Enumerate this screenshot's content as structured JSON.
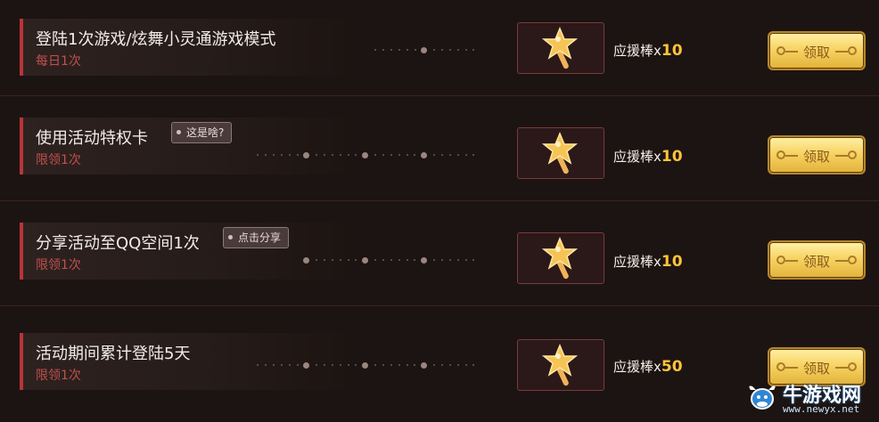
{
  "tasks": [
    {
      "title": "登陆1次游戏/炫舞小灵通游戏模式",
      "limit": "每日1次",
      "tag": "",
      "reward_name": "应援棒",
      "reward_x": "x",
      "reward_count": "10",
      "claim_label": "领取"
    },
    {
      "title": "使用活动特权卡",
      "limit": "限领1次",
      "tag": "这是啥?",
      "reward_name": "应援棒",
      "reward_x": "x",
      "reward_count": "10",
      "claim_label": "领取"
    },
    {
      "title": "分享活动至QQ空间1次",
      "limit": "限领1次",
      "tag": "点击分享",
      "reward_name": "应援棒",
      "reward_x": "x",
      "reward_count": "10",
      "claim_label": "领取"
    },
    {
      "title": "活动期间累计登陆5天",
      "limit": "限领1次",
      "tag": "",
      "reward_name": "应援棒",
      "reward_x": "x",
      "reward_count": "50",
      "claim_label": "领取"
    }
  ],
  "reward_icon": "star-wand-icon",
  "colors": {
    "accent": "#b8353a",
    "gold": "#ffc43a",
    "button": "#f7d463"
  },
  "watermark": {
    "brand": "牛游戏网",
    "url": "www.newyx.net",
    "logo_icon": "bull-logo-icon"
  }
}
